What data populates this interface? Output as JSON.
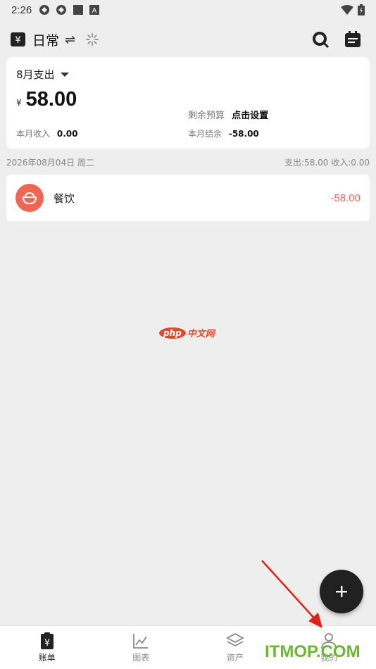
{
  "status_bar": {
    "time": "2:26",
    "icons": [
      "sync-icon",
      "sync-icon",
      "square-icon",
      "font-a-icon"
    ],
    "right_icons": [
      "wifi-icon",
      "battery-icon"
    ]
  },
  "top_bar": {
    "book_title": "日常",
    "switch_symbol": "⇌"
  },
  "summary": {
    "month_label": "8月支出",
    "currency": "¥",
    "amount": "58.00",
    "budget_label": "剩余预算",
    "budget_value": "点击设置",
    "income_label": "本月收入",
    "income_value": "0.00",
    "balance_label": "本月结余",
    "balance_value": "-58.00"
  },
  "day_group": {
    "date": "2026年08月04日 周二",
    "totals": "支出:58.00  收入:0.00"
  },
  "records": [
    {
      "category": "餐饮",
      "amount": "-58.00",
      "icon": "rice-bowl-icon",
      "color": "#ef6652"
    }
  ],
  "watermark": {
    "brand": "php",
    "text": "中文网"
  },
  "fab": {
    "symbol": "+"
  },
  "bottom_nav": [
    {
      "label": "账单",
      "icon": "bill-icon",
      "active": true
    },
    {
      "label": "图表",
      "icon": "chart-icon",
      "active": false
    },
    {
      "label": "资产",
      "icon": "layers-icon",
      "active": false
    },
    {
      "label": "我的",
      "icon": "user-icon",
      "active": false
    }
  ],
  "overlay": {
    "site_watermark": "ITMOP.COM"
  },
  "colors": {
    "accent_dark": "#212121",
    "expense": "#e8655a",
    "background": "#eeeeee",
    "watermark_green": "#6bb82e"
  }
}
